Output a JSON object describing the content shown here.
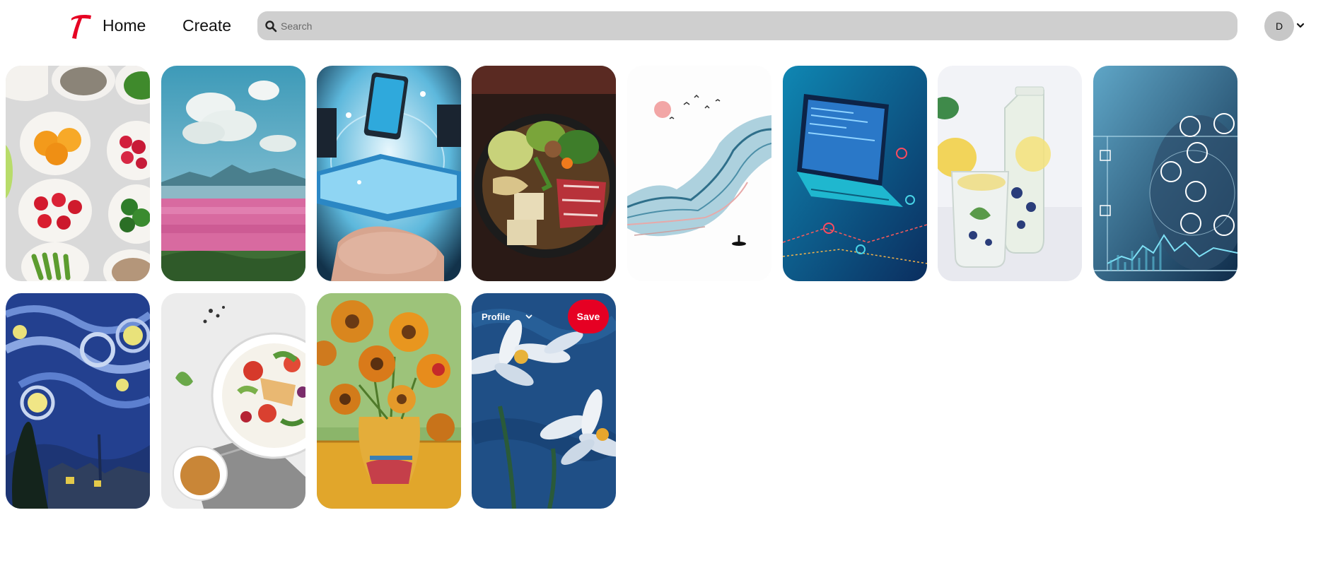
{
  "header": {
    "logo_alt": "T",
    "nav": [
      {
        "label": "Home"
      },
      {
        "label": "Create"
      }
    ],
    "search": {
      "placeholder": "Search",
      "value": ""
    },
    "user": {
      "initial": "D"
    }
  },
  "colors": {
    "brand": "#e60023",
    "search_bg": "#cfcfcf",
    "avatar_bg": "#c7c7c7"
  },
  "pins": [
    {
      "subject": "fruit-bowls",
      "row": 1
    },
    {
      "subject": "pink-flower-lake-landscape",
      "row": 1
    },
    {
      "subject": "hand-holding-digital-devices",
      "row": 1
    },
    {
      "subject": "sukiyaki-hot-pot",
      "row": 1
    },
    {
      "subject": "ink-wash-mountains",
      "row": 1
    },
    {
      "subject": "laptop-circuit-tech",
      "row": 1
    },
    {
      "subject": "lemon-water-glasses",
      "row": 1
    },
    {
      "subject": "digital-network-icons",
      "row": 1
    },
    {
      "subject": "starry-night-painting",
      "row": 2
    },
    {
      "subject": "salad-bowl",
      "row": 2
    },
    {
      "subject": "sunflowers-painting",
      "row": 2
    },
    {
      "subject": "white-flowers-painting",
      "row": 2
    }
  ],
  "hovered_pin": {
    "profile_label": "Profile",
    "save_label": "Save"
  }
}
